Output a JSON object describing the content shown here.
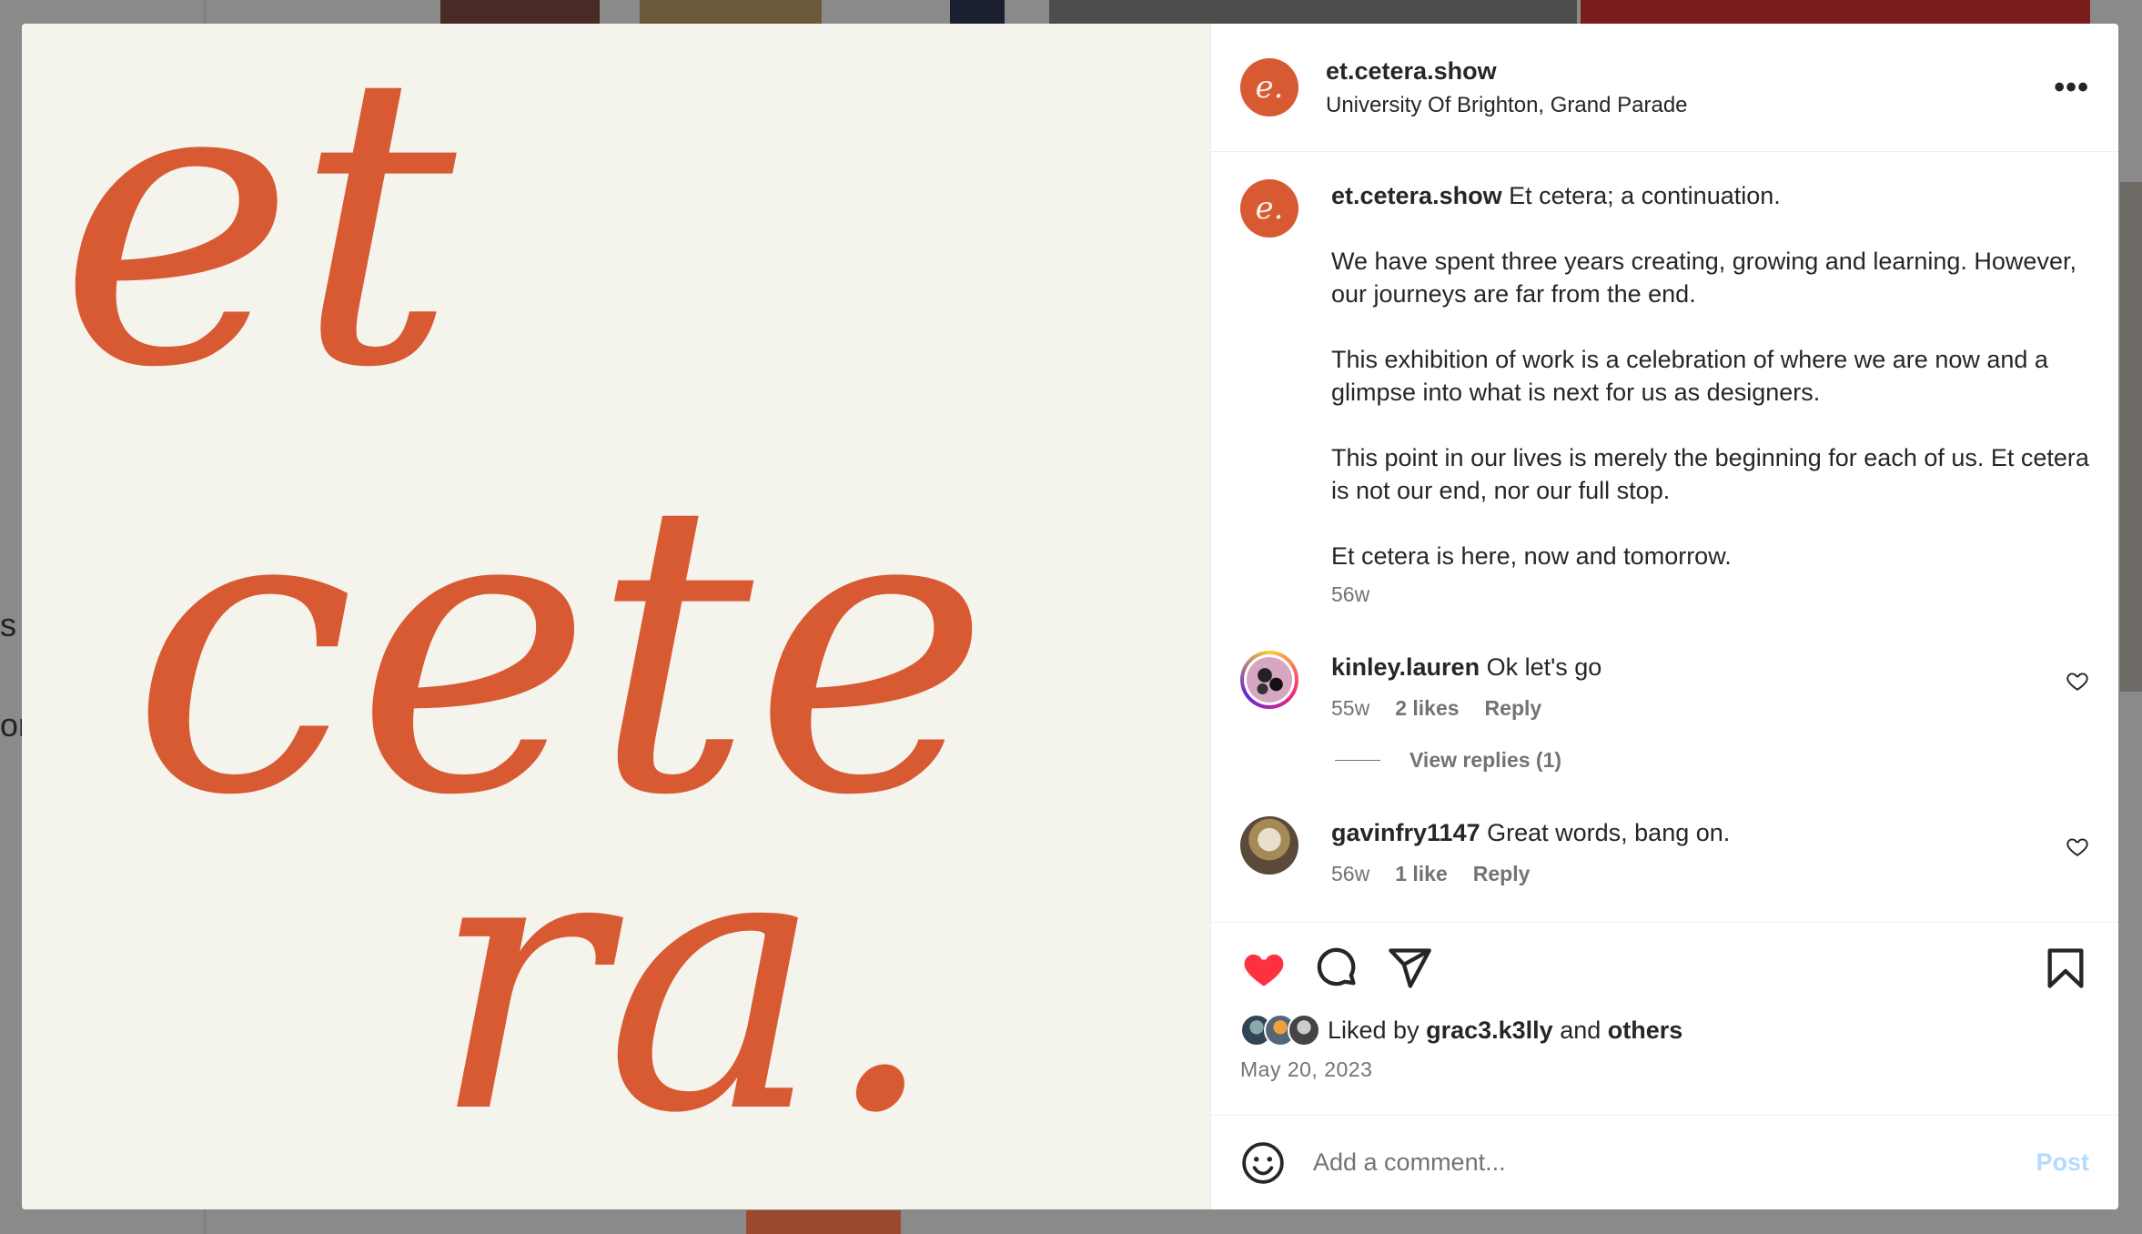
{
  "background": {
    "fragment_1": "s",
    "fragment_2": "or"
  },
  "media": {
    "artwork_words": [
      "et",
      "cete",
      "ra."
    ],
    "accent_color": "#d85a33",
    "background_color": "#f4f3ec"
  },
  "post": {
    "avatar_glyph": "e.",
    "username": "et.cetera.show",
    "location": "University Of Brighton, Grand Parade",
    "more_label": "•••"
  },
  "caption": {
    "username": "et.cetera.show",
    "first_line": " Et cetera; a continuation.",
    "paragraphs": [
      "We have spent three years creating, growing and learning. However, our journeys are far from the end.",
      "This exhibition of work is a celebration of where we are now and a glimpse into what is next for us as designers.",
      "This point in our lives is merely the beginning for each of us. Et cetera is not our end, nor our full stop.",
      "Et cetera is here, now and tomorrow."
    ],
    "age": "56w"
  },
  "comments": [
    {
      "username": "kinley.lauren",
      "text": " Ok let's go",
      "age": "55w",
      "likes": "2 likes",
      "reply": "Reply",
      "view_replies": "View replies (1)"
    },
    {
      "username": "gavinfry1147",
      "text": " Great words, bang on.",
      "age": "56w",
      "likes": "1 like",
      "reply": "Reply"
    }
  ],
  "actions": {
    "like_color": "#ff3040",
    "liked_prefix": "Liked by ",
    "liked_user": "grac3.k3lly",
    "liked_middle": " and ",
    "liked_others": "others",
    "date": "May 20, 2023"
  },
  "add_comment": {
    "placeholder": "Add a comment...",
    "post_label": "Post"
  }
}
